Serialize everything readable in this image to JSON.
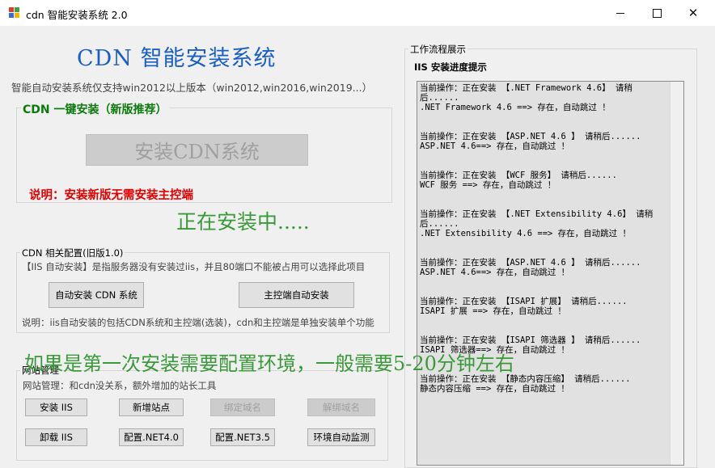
{
  "window": {
    "title": "cdn 智能安装系统 2.0"
  },
  "header": {
    "title": "CDN 智能安装系统",
    "support": "智能自动安装系统仅支持win2012以上版本（win2012,win2016,win2019...）"
  },
  "one_click": {
    "legend": "CDN 一键安装（新版推荐）",
    "install_button": "安装CDN系统",
    "note": "说明：安装新版无需安装主控端"
  },
  "status": {
    "installing": "正在安装中....."
  },
  "legacy": {
    "legend": "CDN 相关配置(旧版1.0)",
    "iis_desc": "【IIS 自动安装】是指服务器没有安装过iis，并且80端口不能被占用可以选择此项目",
    "auto_cdn_button": "自动安装 CDN 系统",
    "master_button": "主控端自动安装",
    "note": "说明：iis自动安装的包括CDN系统和主控端(选装)，cdn和主控端是单独安装单个功能"
  },
  "site": {
    "legend": "网站管理",
    "desc": "网站管理：和cdn没关系，额外增加的站长工具",
    "buttons": {
      "install_iis": "安装 IIS",
      "add_site": "新增站点",
      "bind_domain": "绑定域名",
      "unbind_domain": "解绑域名",
      "uninstall_iis": "卸载 IIS",
      "config_net4": "配置.NET4.0",
      "config_net35": "配置.NET3.5",
      "env_check": "环境自动监测"
    }
  },
  "overlay": {
    "message": "如果是第一次安装需要配置环境，一般需要5-20分钟左右"
  },
  "workflow": {
    "legend": "工作流程展示",
    "progress_title": "IIS 安装进度提示",
    "log": [
      {
        "op": "当前操作：正在安装 【.NET Framework 4.6】 请稍后......",
        "result": ".NET Framework 4.6 ==> 存在，自动跳过 ！"
      },
      {
        "op": "当前操作：正在安装 【ASP.NET 4.6 】 请稍后......",
        "result": "ASP.NET 4.6==> 存在，自动跳过 ！"
      },
      {
        "op": "当前操作：正在安装 【WCF 服务】 请稍后......",
        "result": "WCF 服务 ==> 存在，自动跳过 ！"
      },
      {
        "op": "当前操作：正在安装 【.NET Extensibility 4.6】 请稍后......",
        "result": ".NET Extensibility 4.6 ==> 存在，自动跳过 ！"
      },
      {
        "op": "当前操作：正在安装 【ASP.NET 4.6 】 请稍后......",
        "result": "ASP.NET 4.6==> 存在，自动跳过 ！"
      },
      {
        "op": "当前操作：正在安装 【ISAPI 扩展】 请稍后......",
        "result": "ISAPI 扩展 ==> 存在，自动跳过 ！"
      },
      {
        "op": "当前操作：正在安装 【ISAPI 筛选器 】 请稍后......",
        "result": "ISAPI 筛选器==> 存在，自动跳过 ！"
      },
      {
        "op": "当前操作：正在安装 【静态内容压缩】 请稍后......",
        "result": "静态内容压缩 ==> 存在，自动跳过 ！"
      }
    ]
  },
  "colors": {
    "title_blue": "#1a5fc6",
    "legend_green": "#0b7a0b",
    "note_red": "#e00000",
    "status_green": "#3a9a3a",
    "icon_red": "#e23b2e",
    "icon_green": "#3aa53a",
    "icon_blue": "#2f6fd6",
    "icon_yellow": "#f2b400"
  },
  "icons": {
    "app": "windows-logo-icon",
    "minimize": "minimize-icon",
    "maximize": "maximize-icon",
    "close": "close-icon"
  }
}
